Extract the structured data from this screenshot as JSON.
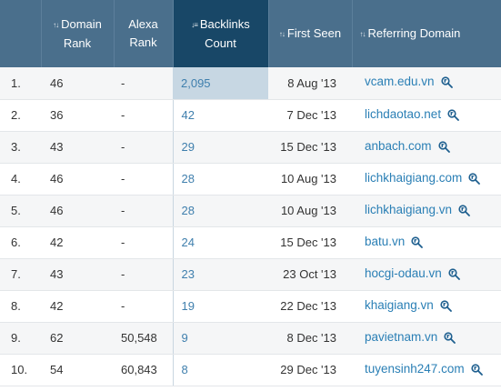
{
  "headers": {
    "rank": "",
    "domain_rank": "Domain Rank",
    "alexa_rank": "Alexa Rank",
    "backlinks_count": "Backlinks Count",
    "first_seen": "First Seen",
    "referring_domain": "Referring Domain"
  },
  "sorted_column": "backlinks_count",
  "colors": {
    "header_bg": "#4a6f8c",
    "header_sorted_bg": "#184767",
    "link": "#2a7fb5",
    "backlink_value": "#3f7fad"
  },
  "rows": [
    {
      "index": "1.",
      "domain_rank": "46",
      "alexa_rank": "-",
      "backlinks": "2,095",
      "first_seen": "8 Aug '13",
      "domain": "vcam.edu.vn"
    },
    {
      "index": "2.",
      "domain_rank": "36",
      "alexa_rank": "-",
      "backlinks": "42",
      "first_seen": "7 Dec '13",
      "domain": "lichdaotao.net"
    },
    {
      "index": "3.",
      "domain_rank": "43",
      "alexa_rank": "-",
      "backlinks": "29",
      "first_seen": "15 Dec '13",
      "domain": "anbach.com"
    },
    {
      "index": "4.",
      "domain_rank": "46",
      "alexa_rank": "-",
      "backlinks": "28",
      "first_seen": "10 Aug '13",
      "domain": "lichkhaigiang.com"
    },
    {
      "index": "5.",
      "domain_rank": "46",
      "alexa_rank": "-",
      "backlinks": "28",
      "first_seen": "10 Aug '13",
      "domain": "lichkhaigiang.vn"
    },
    {
      "index": "6.",
      "domain_rank": "42",
      "alexa_rank": "-",
      "backlinks": "24",
      "first_seen": "15 Dec '13",
      "domain": "batu.vn"
    },
    {
      "index": "7.",
      "domain_rank": "43",
      "alexa_rank": "-",
      "backlinks": "23",
      "first_seen": "23 Oct '13",
      "domain": "hocgi-odau.vn"
    },
    {
      "index": "8.",
      "domain_rank": "42",
      "alexa_rank": "-",
      "backlinks": "19",
      "first_seen": "22 Dec '13",
      "domain": "khaigiang.vn"
    },
    {
      "index": "9.",
      "domain_rank": "62",
      "alexa_rank": "50,548",
      "backlinks": "9",
      "first_seen": "8 Dec '13",
      "domain": "pavietnam.vn"
    },
    {
      "index": "10.",
      "domain_rank": "54",
      "alexa_rank": "60,843",
      "backlinks": "8",
      "first_seen": "29 Dec '13",
      "domain": "tuyensinh247.com"
    }
  ]
}
